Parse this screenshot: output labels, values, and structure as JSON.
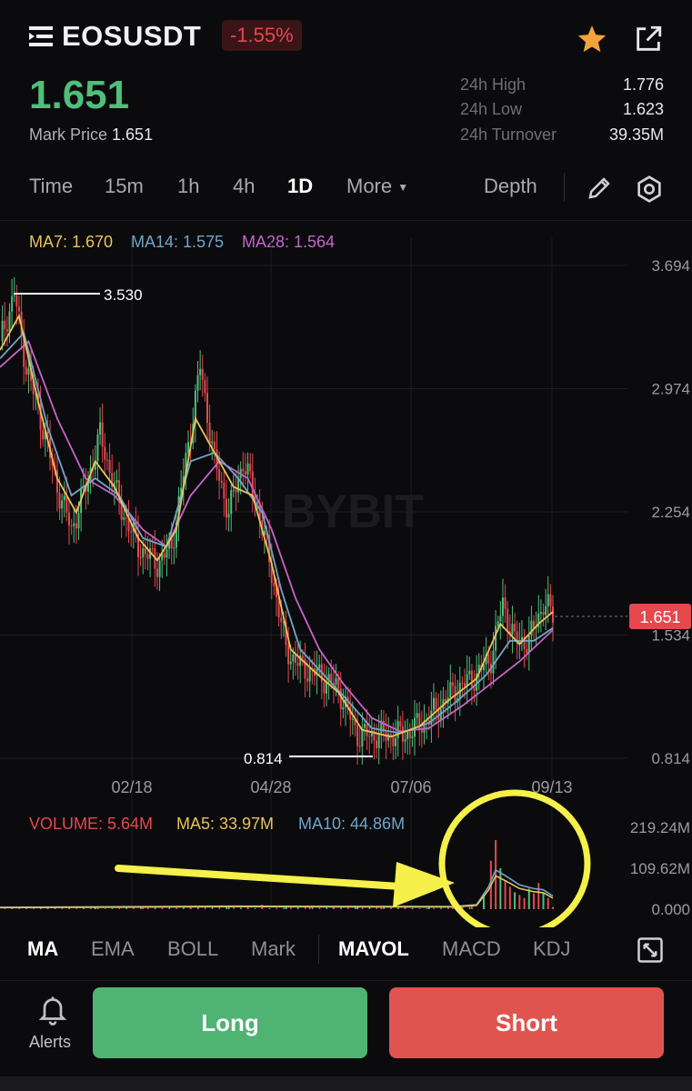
{
  "header": {
    "symbol": "EOSUSDT",
    "change_pct": "-1.55%",
    "last_price": "1.651",
    "mark_label": "Mark Price",
    "mark_value": "1.651",
    "stats": [
      {
        "label": "24h High",
        "value": "1.776"
      },
      {
        "label": "24h Low",
        "value": "1.623"
      },
      {
        "label": "24h Turnover",
        "value": "39.35M"
      }
    ],
    "icons": [
      "menu-icon",
      "star-icon",
      "share-icon"
    ]
  },
  "intervals": {
    "tabs": [
      "Time",
      "15m",
      "1h",
      "4h",
      "1D",
      "More"
    ],
    "active": "1D",
    "depth_label": "Depth",
    "icons": [
      "pencil-icon",
      "settings-icon"
    ]
  },
  "ma_legend": {
    "ma7": "MA7: 1.670",
    "ma14": "MA14: 1.575",
    "ma28": "MA28: 1.564"
  },
  "colors": {
    "up": "#4fbf7a",
    "down": "#e5484d",
    "ma7": "#e8c35a",
    "ma14": "#6fa6c8",
    "ma28": "#c665c8",
    "annotation": "#f5f04a"
  },
  "chart_data": [
    {
      "type": "candlestick",
      "watermark": "BYBIT",
      "y_ticks": [
        "3.694",
        "2.974",
        "2.254",
        "1.534",
        "0.814"
      ],
      "ylim": [
        0.814,
        3.694
      ],
      "x_ticks": [
        "02/18",
        "04/28",
        "07/06",
        "09/13"
      ],
      "current_price_tag": "1.651",
      "high_marker": "3.530",
      "low_marker": "0.814",
      "close_path": [
        [
          0,
          3.25
        ],
        [
          6,
          3.53
        ],
        [
          11,
          3.1
        ],
        [
          18,
          2.75
        ],
        [
          24,
          2.4
        ],
        [
          30,
          2.15
        ],
        [
          36,
          2.4
        ],
        [
          42,
          2.7
        ],
        [
          50,
          2.3
        ],
        [
          58,
          2.05
        ],
        [
          66,
          1.95
        ],
        [
          72,
          2.05
        ],
        [
          78,
          2.55
        ],
        [
          84,
          3.1
        ],
        [
          90,
          2.55
        ],
        [
          96,
          2.25
        ],
        [
          102,
          2.55
        ],
        [
          108,
          2.3
        ],
        [
          114,
          1.9
        ],
        [
          120,
          1.45
        ],
        [
          126,
          1.35
        ],
        [
          134,
          1.3
        ],
        [
          142,
          1.22
        ],
        [
          150,
          0.95
        ],
        [
          160,
          0.95
        ],
        [
          170,
          0.95
        ],
        [
          180,
          1.05
        ],
        [
          190,
          1.2
        ],
        [
          200,
          1.3
        ],
        [
          206,
          1.4
        ],
        [
          211,
          1.72
        ],
        [
          216,
          1.5
        ],
        [
          222,
          1.5
        ],
        [
          228,
          1.72
        ],
        [
          232,
          1.651
        ]
      ],
      "ma7": [
        [
          0,
          3.2
        ],
        [
          8,
          3.4
        ],
        [
          16,
          2.9
        ],
        [
          24,
          2.45
        ],
        [
          32,
          2.25
        ],
        [
          40,
          2.55
        ],
        [
          48,
          2.4
        ],
        [
          58,
          2.1
        ],
        [
          66,
          1.97
        ],
        [
          74,
          2.15
        ],
        [
          82,
          2.8
        ],
        [
          90,
          2.6
        ],
        [
          98,
          2.4
        ],
        [
          106,
          2.35
        ],
        [
          114,
          1.95
        ],
        [
          122,
          1.45
        ],
        [
          132,
          1.32
        ],
        [
          142,
          1.2
        ],
        [
          152,
          0.98
        ],
        [
          164,
          0.94
        ],
        [
          176,
          1.0
        ],
        [
          188,
          1.15
        ],
        [
          200,
          1.28
        ],
        [
          210,
          1.6
        ],
        [
          218,
          1.48
        ],
        [
          226,
          1.6
        ],
        [
          232,
          1.67
        ]
      ],
      "ma14": [
        [
          0,
          3.15
        ],
        [
          10,
          3.3
        ],
        [
          20,
          2.75
        ],
        [
          30,
          2.35
        ],
        [
          40,
          2.45
        ],
        [
          50,
          2.35
        ],
        [
          60,
          2.1
        ],
        [
          70,
          2.05
        ],
        [
          80,
          2.55
        ],
        [
          90,
          2.6
        ],
        [
          100,
          2.45
        ],
        [
          110,
          2.25
        ],
        [
          118,
          1.8
        ],
        [
          126,
          1.45
        ],
        [
          136,
          1.3
        ],
        [
          146,
          1.15
        ],
        [
          156,
          0.99
        ],
        [
          168,
          0.96
        ],
        [
          180,
          1.02
        ],
        [
          192,
          1.15
        ],
        [
          204,
          1.3
        ],
        [
          214,
          1.5
        ],
        [
          224,
          1.5
        ],
        [
          232,
          1.575
        ]
      ],
      "ma28": [
        [
          0,
          3.1
        ],
        [
          12,
          3.25
        ],
        [
          24,
          2.8
        ],
        [
          36,
          2.45
        ],
        [
          48,
          2.35
        ],
        [
          60,
          2.15
        ],
        [
          70,
          2.05
        ],
        [
          80,
          2.35
        ],
        [
          92,
          2.55
        ],
        [
          104,
          2.45
        ],
        [
          114,
          2.15
        ],
        [
          124,
          1.75
        ],
        [
          134,
          1.45
        ],
        [
          144,
          1.25
        ],
        [
          156,
          1.05
        ],
        [
          168,
          0.97
        ],
        [
          180,
          0.99
        ],
        [
          194,
          1.12
        ],
        [
          206,
          1.25
        ],
        [
          218,
          1.38
        ],
        [
          232,
          1.564
        ]
      ]
    },
    {
      "type": "bar",
      "title": "VOLUME",
      "volume_label": "VOLUME: 5.64M",
      "ma5_label": "MA5: 33.97M",
      "ma10_label": "MA10: 44.86M",
      "y_ticks": [
        "219.24M",
        "109.62M",
        "0.000"
      ],
      "ylim": [
        0,
        219.24
      ],
      "bars": [
        [
          20,
          4
        ],
        [
          40,
          6
        ],
        [
          60,
          5
        ],
        [
          80,
          8
        ],
        [
          96,
          10
        ],
        [
          104,
          9
        ],
        [
          110,
          12
        ],
        [
          120,
          7
        ],
        [
          130,
          5
        ],
        [
          140,
          6
        ],
        [
          150,
          5
        ],
        [
          160,
          6
        ],
        [
          170,
          9
        ],
        [
          180,
          8
        ],
        [
          190,
          6
        ],
        [
          198,
          7
        ],
        [
          203,
          40
        ],
        [
          206,
          130
        ],
        [
          208,
          185
        ],
        [
          210,
          110
        ],
        [
          212,
          75
        ],
        [
          214,
          60
        ],
        [
          216,
          45
        ],
        [
          218,
          38
        ],
        [
          220,
          30
        ],
        [
          222,
          55
        ],
        [
          224,
          42
        ],
        [
          226,
          70
        ],
        [
          228,
          45
        ],
        [
          230,
          30
        ],
        [
          232,
          6
        ]
      ],
      "ma_lines": [
        [
          0,
          5
        ],
        [
          100,
          8
        ],
        [
          190,
          7
        ],
        [
          200,
          12
        ],
        [
          205,
          60
        ],
        [
          208,
          105
        ],
        [
          212,
          90
        ],
        [
          218,
          65
        ],
        [
          224,
          55
        ],
        [
          228,
          52
        ],
        [
          232,
          35
        ]
      ]
    }
  ],
  "annotation": {
    "arrow_color": "#f5f04a",
    "circle_color": "#f5f04a"
  },
  "indicators": {
    "tabs": [
      "MA",
      "EMA",
      "BOLL",
      "Mark",
      "MAVOL",
      "MACD",
      "KDJ"
    ],
    "active_main": "MA",
    "active_sub": "MAVOL"
  },
  "bottom": {
    "alerts_label": "Alerts",
    "long_label": "Long",
    "short_label": "Short"
  }
}
